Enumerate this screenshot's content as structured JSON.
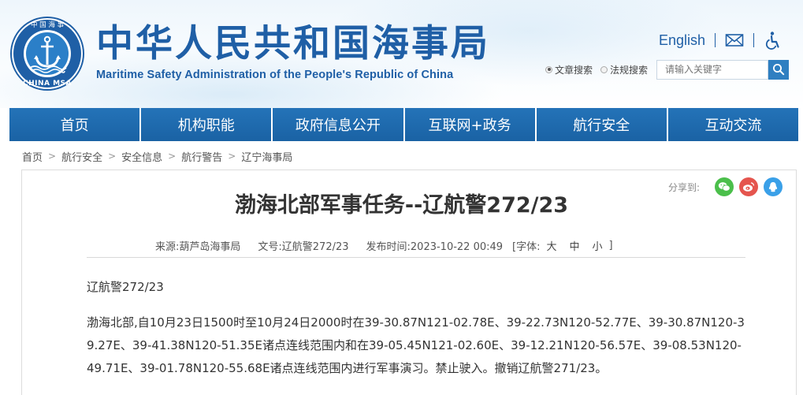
{
  "header": {
    "title_cn": "中华人民共和国海事局",
    "title_en": "Maritime Safety Administration of the People's Republic of China",
    "logo_text_top": "中 国 海 事",
    "logo_text_bottom": "CHINA MSA",
    "english_link": "English",
    "icons": [
      "mail-icon",
      "accessibility-icon"
    ],
    "search": {
      "options": [
        "文章搜索",
        "法规搜索"
      ],
      "selected": "文章搜索",
      "placeholder": "请输入关键字"
    }
  },
  "nav": {
    "items": [
      "首页",
      "机构职能",
      "政府信息公开",
      "互联网+政务",
      "航行安全",
      "互动交流"
    ]
  },
  "breadcrumb": [
    "首页",
    "航行安全",
    "安全信息",
    "航行警告",
    "辽宁海事局"
  ],
  "share": {
    "label": "分享到:",
    "icons": [
      "wechat-icon",
      "weibo-icon",
      "qq-icon"
    ]
  },
  "article": {
    "title": "渤海北部军事任务--辽航警272/23",
    "source": "来源:葫芦岛海事局",
    "doc_no": "文号:辽航警272/23",
    "publish_time": "发布时间:2023-10-22 00:49",
    "font_label_open": "[字体:",
    "font_sizes": [
      "大",
      "中",
      "小"
    ],
    "font_label_close": "]",
    "para1": "辽航警272/23",
    "para2": "渤海北部,自10月23日1500时至10月24日2000时在39-30.87N121-02.78E、39-22.73N120-52.77E、39-30.87N120-39.27E、39-41.38N120-51.35E诸点连线范围内和在39-05.45N121-02.60E、39-12.21N120-56.57E、39-08.53N120-49.71E、39-01.78N120-55.68E诸点连线范围内进行军事演习。禁止驶入。撤销辽航警271/23。"
  },
  "colors": {
    "brand_blue": "#1f5fa6",
    "nav_blue": "#1f6aad",
    "wechat_green": "#4bbf4b",
    "weibo_red": "#e5554e",
    "qq_blue": "#3aa0e8"
  }
}
